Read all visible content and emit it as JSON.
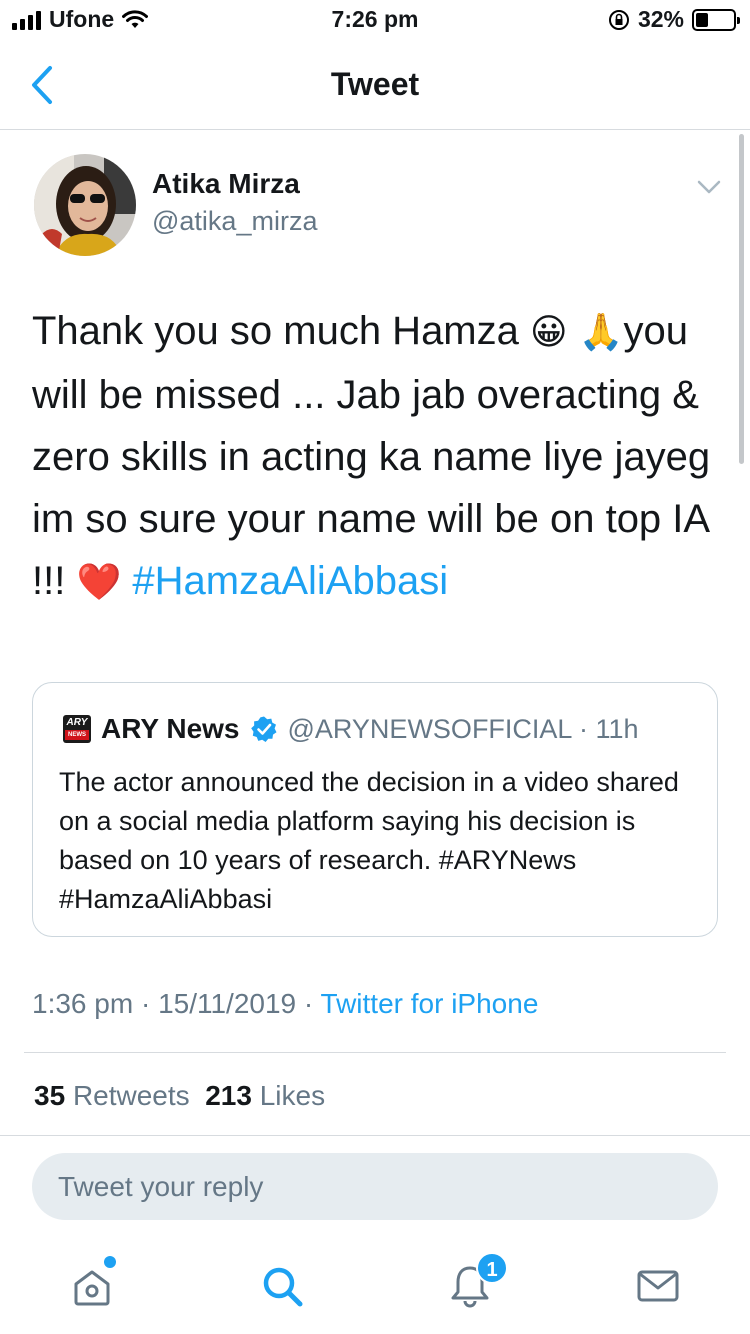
{
  "status_bar": {
    "carrier": "Ufone",
    "time": "7:26 pm",
    "battery_percent": "32%",
    "battery_level": 0.32,
    "icons": [
      "signal-icon",
      "wifi-icon",
      "orientation-lock-icon",
      "battery-icon"
    ]
  },
  "nav": {
    "title": "Tweet",
    "back_icon": "chevron-left-icon"
  },
  "tweet": {
    "author_name": "Atika Mirza",
    "author_handle": "@atika_mirza",
    "text_part1": "Thank you so much Hamza ",
    "emoji1": "😀",
    "emoji2": "🙏",
    "text_part2": "you will be missed ... Jab jab overacting & zero skills in acting ka name liye jayeg im so sure your name will be on top IA !!! ",
    "emoji3": "❤️",
    "hashtag": "#HamzaAliAbbasi",
    "time": "1:36 pm",
    "date": "15/11/2019",
    "separator": " · ",
    "source": "Twitter for iPhone",
    "retweets_count": "35",
    "retweets_label": "Retweets",
    "likes_count": "213",
    "likes_label": "Likes"
  },
  "quoted": {
    "logo_text_top": "ARY",
    "logo_text_bottom": "NEWS",
    "name": "ARY News",
    "handle": "@ARYNEWSOFFICIAL",
    "separator": " · ",
    "age": "11h",
    "text": "The actor announced the decision in a video shared on a social media platform saying his decision is based on 10 years of research. #ARYNews #HamzaAliAbbasi"
  },
  "reply": {
    "placeholder": "Tweet your reply"
  },
  "tabbar": {
    "items": [
      {
        "name": "home",
        "icon": "home-icon"
      },
      {
        "name": "search",
        "icon": "search-icon"
      },
      {
        "name": "notifications",
        "icon": "bell-icon",
        "badge": "1"
      },
      {
        "name": "messages",
        "icon": "mail-icon"
      }
    ]
  },
  "colors": {
    "accent": "#1da1f2",
    "secondary_text": "#657786",
    "text": "#14171a",
    "divider": "#d7dbdf",
    "reply_bg": "#e6ecf0"
  }
}
